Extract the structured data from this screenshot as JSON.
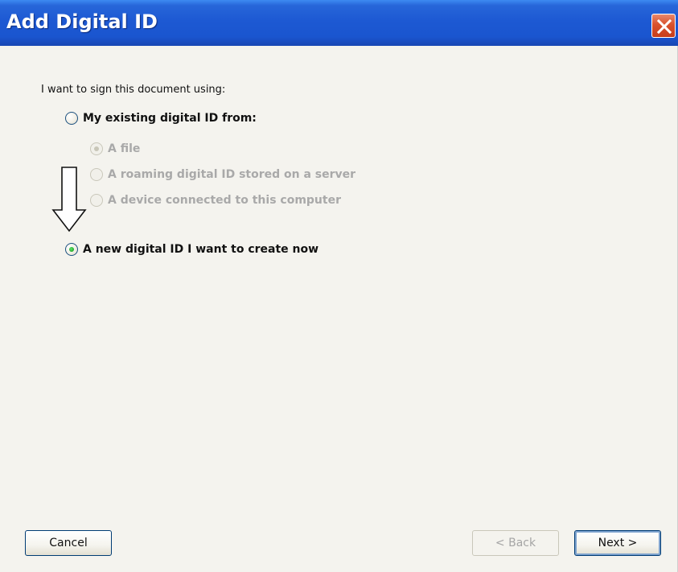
{
  "window": {
    "title": "Add Digital ID",
    "close_icon": "close-icon"
  },
  "main": {
    "prompt": "I want to sign this document using:",
    "options": {
      "existing": {
        "label": "My existing digital ID from:",
        "selected": false,
        "enabled": true
      },
      "file": {
        "label": "A file",
        "selected": true,
        "enabled": false
      },
      "roaming": {
        "label": "A roaming digital ID stored on a server",
        "selected": false,
        "enabled": false
      },
      "device": {
        "label": "A device connected to this computer",
        "selected": false,
        "enabled": false
      },
      "new_id": {
        "label": "A new digital ID I want to create now",
        "selected": true,
        "enabled": true
      }
    },
    "annotation_icon": "down-arrow-icon"
  },
  "footer": {
    "cancel_label": "Cancel",
    "back_label": "< Back",
    "next_label": "Next >"
  },
  "colors": {
    "titlebar": "#1d59d3",
    "close_button": "#d9512c",
    "dialog_background": "#f4f3ee",
    "radio_selected_dot": "#22a82b",
    "disabled_text": "#a9a9a9"
  }
}
